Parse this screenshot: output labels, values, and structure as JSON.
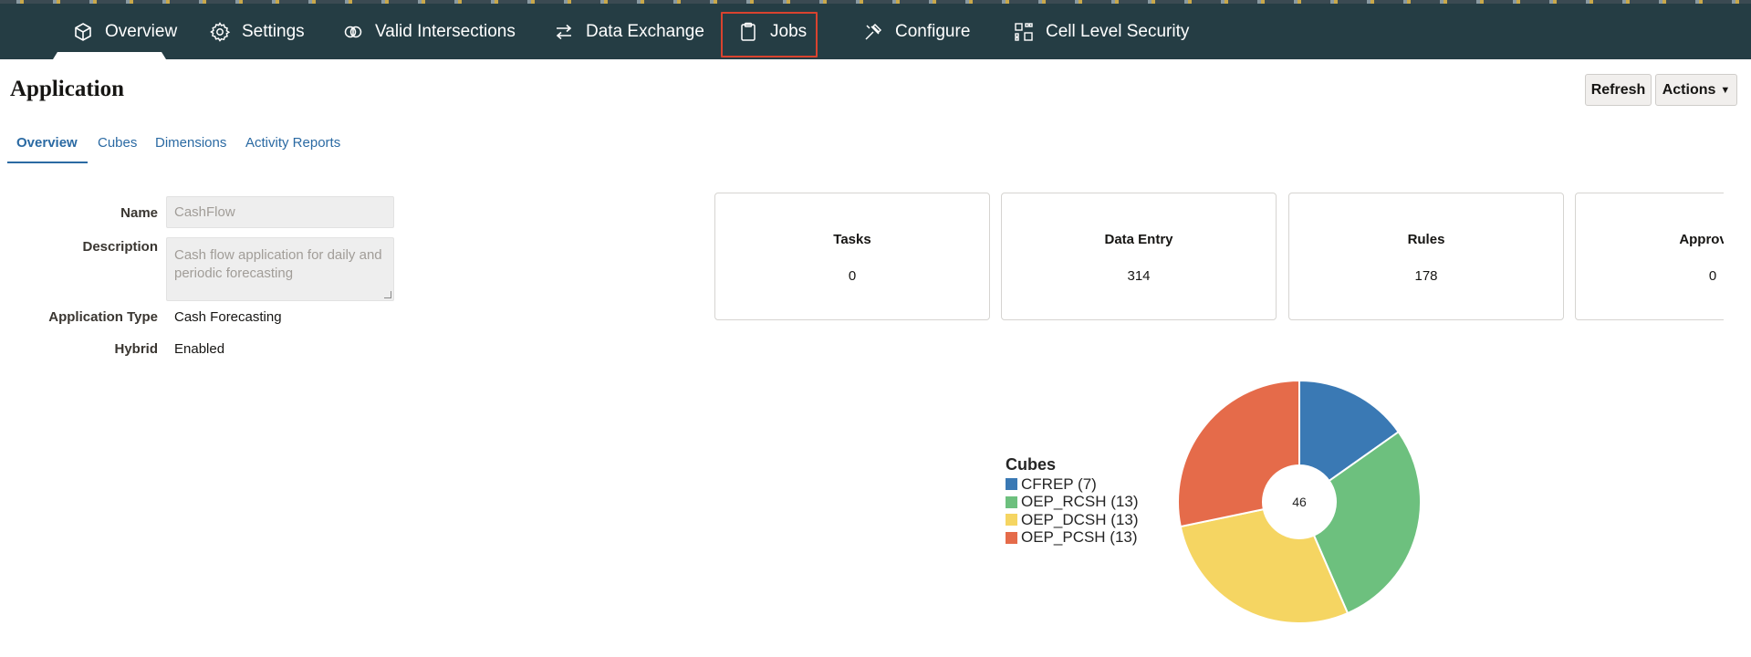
{
  "nav": {
    "items": [
      {
        "label": "Overview",
        "icon": "cube-icon"
      },
      {
        "label": "Settings",
        "icon": "gear-icon"
      },
      {
        "label": "Valid Intersections",
        "icon": "intersections-icon"
      },
      {
        "label": "Data Exchange",
        "icon": "exchange-arrows-icon"
      },
      {
        "label": "Jobs",
        "icon": "clipboard-icon"
      },
      {
        "label": "Configure",
        "icon": "tools-icon"
      },
      {
        "label": "Cell Level Security",
        "icon": "grid-security-icon"
      }
    ],
    "active": "Overview",
    "highlighted": "Jobs"
  },
  "page": {
    "title": "Application",
    "refresh_label": "Refresh",
    "actions_label": "Actions"
  },
  "subtabs": [
    "Overview",
    "Cubes",
    "Dimensions",
    "Activity Reports"
  ],
  "form": {
    "name_label": "Name",
    "name_value": "CashFlow",
    "description_label": "Description",
    "description_value": "Cash flow application for daily and periodic forecasting",
    "type_label": "Application Type",
    "type_value": "Cash Forecasting",
    "hybrid_label": "Hybrid",
    "hybrid_value": "Enabled"
  },
  "cards": [
    {
      "title": "Tasks",
      "value": "0"
    },
    {
      "title": "Data Entry",
      "value": "314"
    },
    {
      "title": "Rules",
      "value": "178"
    },
    {
      "title": "Approvals",
      "value": "0"
    }
  ],
  "chart_data": {
    "type": "pie",
    "legend_title": "Cubes",
    "center_label": "46",
    "slices": [
      {
        "name": "CFREP (7)",
        "value": 7,
        "color": "#3a79b4"
      },
      {
        "name": "OEP_RCSH (13)",
        "value": 13,
        "color": "#6dc07e"
      },
      {
        "name": "OEP_DCSH (13)",
        "value": 13,
        "color": "#f5d562"
      },
      {
        "name": "OEP_PCSH (13)",
        "value": 13,
        "color": "#e56b4a"
      }
    ]
  },
  "colors": {
    "navbar": "#253d44",
    "link": "#2b6aa3",
    "highlight": "#d9432f"
  }
}
